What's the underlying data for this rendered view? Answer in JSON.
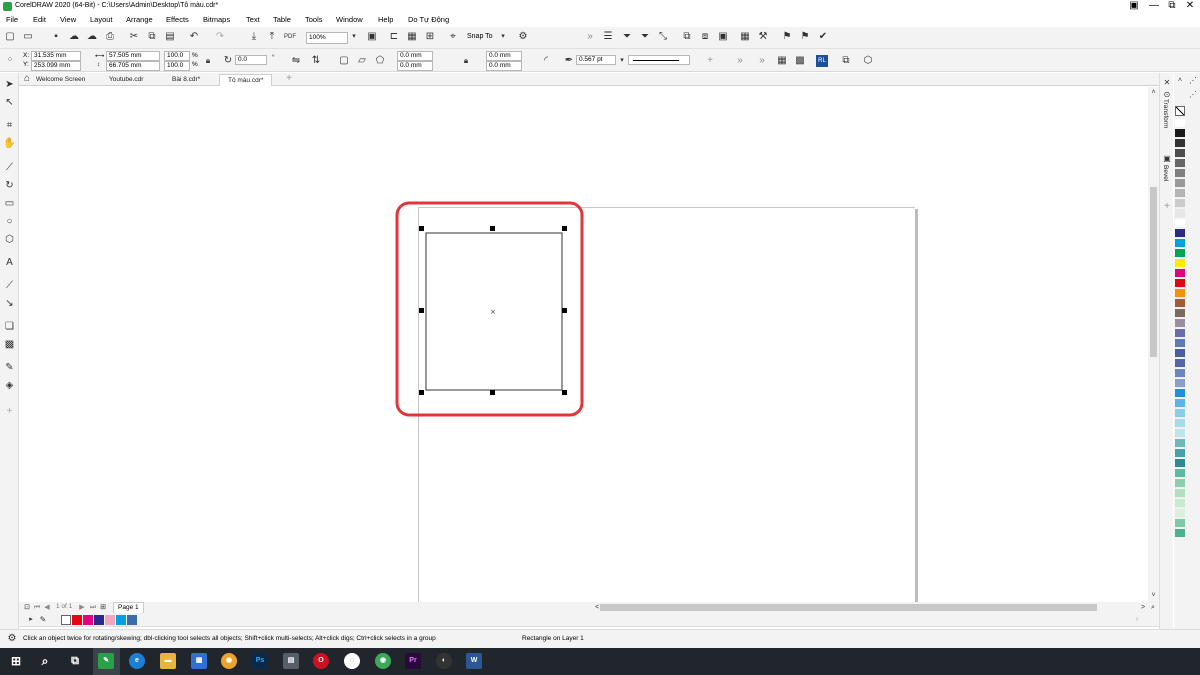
{
  "window": {
    "title": "CorelDRAW 2020 (64-Bit) - C:\\Users\\Admin\\Desktop\\Tô màu.cdr*",
    "controls": {
      "minimize": "—",
      "maximize": "⧉",
      "close": "✕"
    }
  },
  "menu": [
    "File",
    "Edit",
    "View",
    "Layout",
    "Arrange",
    "Effects",
    "Bitmaps",
    "Text",
    "Table",
    "Tools",
    "Window",
    "Help",
    "Do Tự Động"
  ],
  "toolbar": {
    "zoom_value": "100%",
    "snap_to": "Snap To"
  },
  "propertybar": {
    "x_label": "X:",
    "y_label": "Y:",
    "x_value": "31.535 mm",
    "y_value": "253.099 mm",
    "width_value": "57.505 mm",
    "height_value": "66.705 mm",
    "scale_w": "100.0",
    "scale_h": "100.0",
    "pct1": "%",
    "pct2": "%",
    "rotation": "0.0",
    "corner_a": "0.0 mm",
    "corner_b": "0.0 mm",
    "corner_c": "0.0 mm",
    "corner_d": "0.0 mm",
    "outline_width": "0.567 pt"
  },
  "tabs": [
    "Welcome Screen",
    "Youtube.cdr",
    "Bài 8.cdr*",
    "Tô màu.cdr*"
  ],
  "active_tab": "Tô màu.cdr*",
  "dockers": [
    "Transform",
    "Bevel"
  ],
  "page_nav": {
    "counter": "1 of 1",
    "page_tab": "Page 1"
  },
  "status": {
    "hint": "Click an object twice for rotating/skewing; dbl-clicking tool selects all objects; Shift+click multi-selects; Alt+click digs; Ctrl+click selects in a group",
    "selection": "Rectangle on Layer 1"
  },
  "colors": {
    "highlight": "#e0353b",
    "chrome": "#f3f3f3",
    "taskbar": "#20262c"
  },
  "palette": [
    "#ffffff",
    "#1a1a1a",
    "#333333",
    "#4d4d4d",
    "#666666",
    "#808080",
    "#999999",
    "#b3b3b3",
    "#cccccc",
    "#e6e6e6",
    "#ffffff",
    "#2a2a8c",
    "#00a0e3",
    "#00a651",
    "#ffed00",
    "#e4007f",
    "#e30613",
    "#f39200",
    "#a05a3c",
    "#7a6b5c",
    "#9b8ea0",
    "#6a6ea8",
    "#5d79b8",
    "#4a5da0",
    "#5366a8",
    "#6a85c0",
    "#8a9dd0",
    "#1e90d6",
    "#5ab4e6",
    "#8acde8",
    "#a6dbe8",
    "#bfe4ec",
    "#6fb8b8",
    "#4aa0a8",
    "#2a8a90",
    "#5fb8a0",
    "#8ad0b0",
    "#b0e0c0",
    "#c8ebd0",
    "#d9f0dc",
    "#7fc8a8",
    "#4cb08c"
  ],
  "doc_palette": [
    "#ffffff",
    "#e30613",
    "#e4007f",
    "#2a2a8c",
    "#f4a6c0",
    "#00a0e3",
    "#3a6ea8"
  ],
  "taskbar_apps": [
    "start",
    "search",
    "task-view",
    "coreldraw",
    "edge",
    "file-explorer",
    "store",
    "chrome",
    "photoshop",
    "calculator",
    "opera",
    "messenger",
    "chrome-2",
    "premiere",
    "media",
    "word"
  ]
}
